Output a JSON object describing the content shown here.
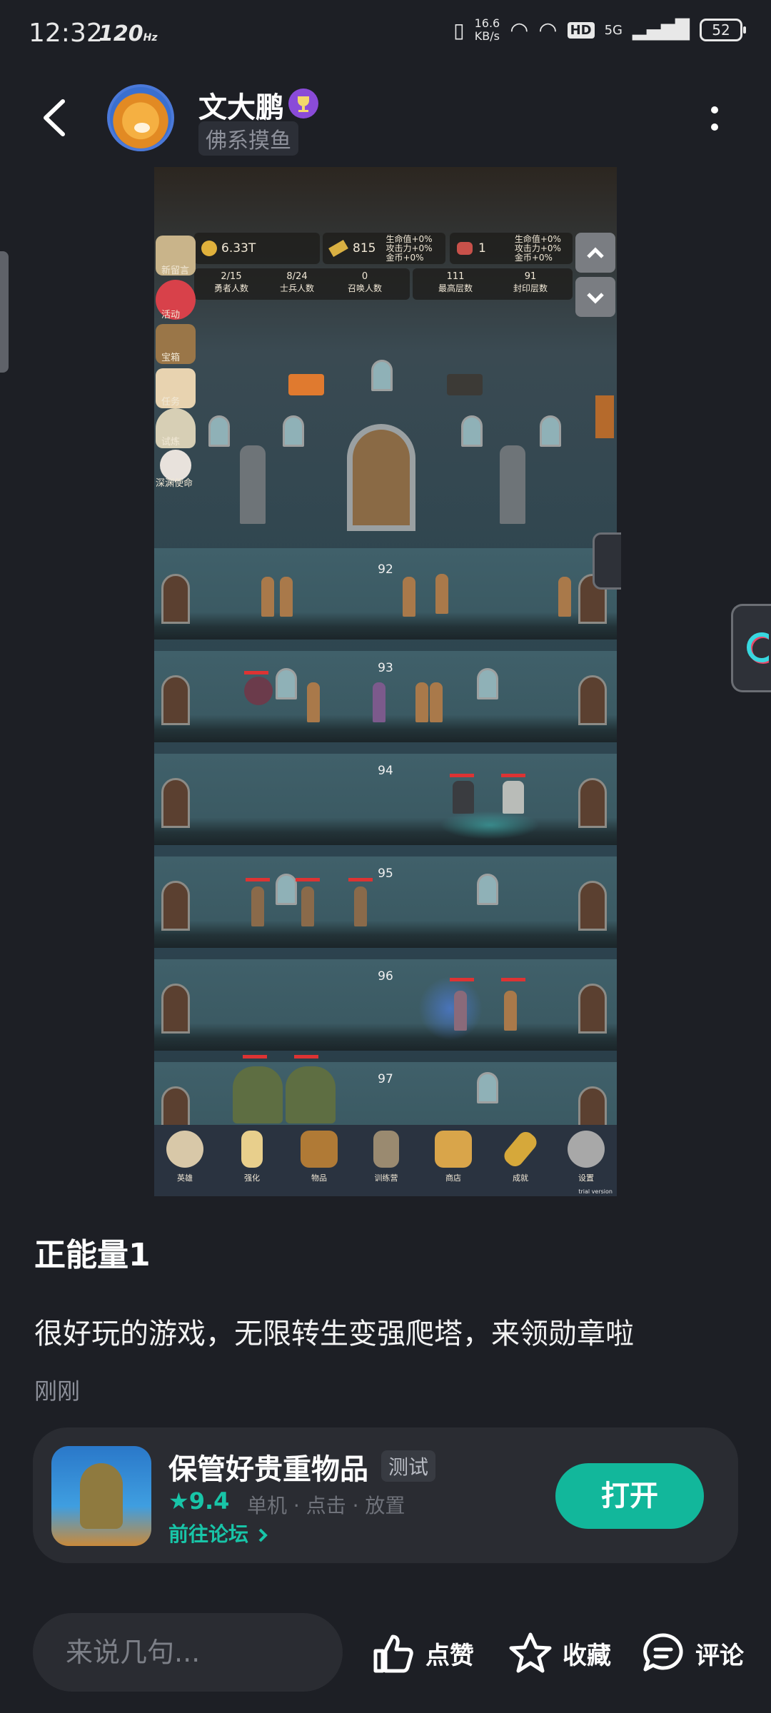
{
  "status_bar": {
    "time": "12:32",
    "refresh_rate": "120",
    "net_speed_value": "16.6",
    "net_speed_unit": "KB/s",
    "hd": "HD",
    "network": "5G",
    "battery": "52"
  },
  "header": {
    "username": "文大鹏",
    "user_tag": "佛系摸鱼"
  },
  "screenshot": {
    "gold": "6.33T",
    "bars": "815",
    "meat": "1",
    "stat_line_1": "生命值+0%",
    "stat_line_2": "攻击力+0%",
    "stat_line_3": "金币+0%",
    "hero_count": "2/15",
    "hero_label": "勇者人数",
    "soldier_count": "8/24",
    "soldier_label": "士兵人数",
    "summon_count": "0",
    "summon_label": "召唤人数",
    "max_floor": "111",
    "max_floor_label": "最高层数",
    "seal_floor": "91",
    "seal_floor_label": "封印层数",
    "side_menu": [
      "新留言",
      "活动",
      "宝箱",
      "任务",
      "试炼",
      "深渊使命"
    ],
    "floors": [
      "92",
      "93",
      "94",
      "95",
      "96",
      "97"
    ],
    "bottom_menu": [
      "英雄",
      "强化",
      "物品",
      "训练营",
      "商店",
      "成就",
      "设置"
    ],
    "trial": "trial version"
  },
  "post": {
    "title": "正能量1",
    "body": "很好玩的游戏，无限转生变强爬塔，来领勋章啦",
    "time": "刚刚"
  },
  "game_card": {
    "name": "保管好贵重物品",
    "tag": "测试",
    "rating": "9.4",
    "tags": "单机 · 点击 · 放置",
    "forum_link": "前往论坛",
    "open_button": "打开"
  },
  "action_bar": {
    "comment_placeholder": "来说几句...",
    "like": "点赞",
    "favorite": "收藏",
    "comment": "评论"
  },
  "colors": {
    "background": "#1d1f25",
    "accent": "#12b79b"
  }
}
